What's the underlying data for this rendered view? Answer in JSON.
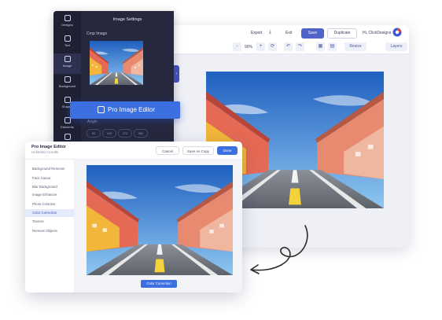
{
  "editor": {
    "topbar": {
      "export_label": "Export",
      "exit_label": "Exit",
      "save_label": "Save",
      "duplicate_label": "Duplicate",
      "greeting": "Hi, ClickDesigns"
    },
    "toolbar": {
      "zoom_out": "-",
      "zoom_value": "90%",
      "zoom_in": "+",
      "resize_label": "Resize",
      "layers_label": "Layers"
    }
  },
  "panel": {
    "title": "Image Settings",
    "crop_label": "Crop Image",
    "angles_label": "Angle",
    "angles": [
      "90",
      "180",
      "270",
      "360"
    ],
    "nav": [
      {
        "label": "Designs",
        "icon": "designs-icon"
      },
      {
        "label": "Text",
        "icon": "text-icon"
      },
      {
        "label": "Image",
        "icon": "image-icon"
      },
      {
        "label": "Background",
        "icon": "background-icon"
      },
      {
        "label": "Shapes",
        "icon": "shapes-icon"
      },
      {
        "label": "Elements",
        "icon": "elements-icon"
      },
      {
        "label": "Icons",
        "icon": "icons-icon"
      }
    ],
    "pro_button_label": "Pro Image Editor"
  },
  "pro_editor": {
    "title": "Pro Image Editor",
    "subtitle": "Unlimited Credits",
    "cancel_label": "Cancel",
    "save_copy_label": "Save As Copy",
    "done_label": "Done",
    "menu": [
      "Background Remover",
      "Face Cutout",
      "Blur Background",
      "Image Enhancer",
      "Photo Colorizer",
      "Color Correction",
      "Toonize",
      "Remove Objects"
    ],
    "active_menu_index": 5,
    "action_button_label": "Color Correction"
  },
  "colors": {
    "accent": "#3c6fe0",
    "save_button": "#4f63c9",
    "panel_dark": "#26283d"
  }
}
